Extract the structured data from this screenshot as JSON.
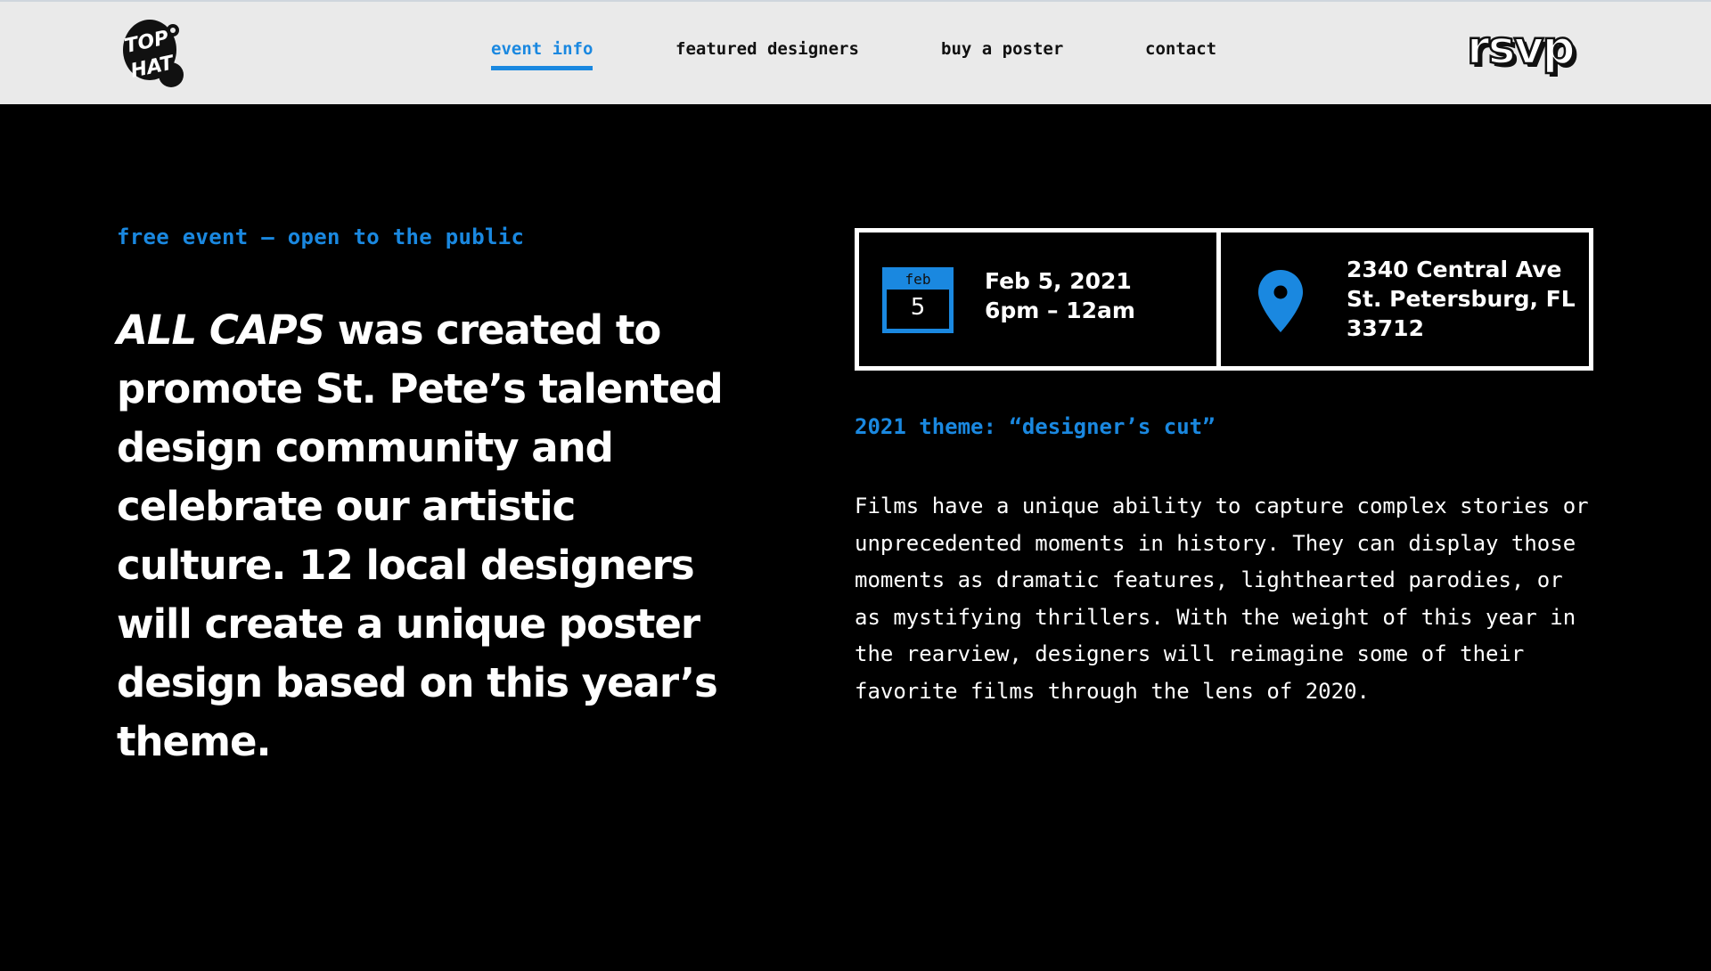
{
  "header": {
    "logo_text": [
      "TOP",
      "HAT"
    ],
    "nav": [
      {
        "label": "event info",
        "active": true
      },
      {
        "label": "featured designers",
        "active": false
      },
      {
        "label": "buy a poster",
        "active": false
      },
      {
        "label": "contact",
        "active": false
      }
    ],
    "rsvp_label": "rsvp"
  },
  "main": {
    "tagline": "free event – open to the public",
    "intro": {
      "emphasis": "ALL CAPS",
      "rest": " was created to promote St. Pete’s talented design community and celebrate our artistic culture. 12 local designers will create a unique poster design based on this year’s theme."
    },
    "event": {
      "calendar_month": "feb",
      "calendar_day": "5",
      "date": "Feb 5, 2021",
      "time": "6pm – 12am"
    },
    "location": {
      "icon": "map-pin-icon",
      "line1": "2340 Central Ave",
      "line2": "St. Petersburg, FL",
      "line3": "33712"
    },
    "theme": "2021 theme: “designer’s cut”",
    "description": "Films have a unique ability to capture complex stories or unprecedented moments in history. They can display those moments as dramatic features, lighthearted parodies, or as mystifying thrillers. With the weight of this year in the rearview, designers will reimagine some of their favorite films through the lens of 2020."
  },
  "colors": {
    "accent": "#1a88e0",
    "background": "#000000",
    "header_bg": "#eaeaea",
    "text": "#ffffff"
  }
}
